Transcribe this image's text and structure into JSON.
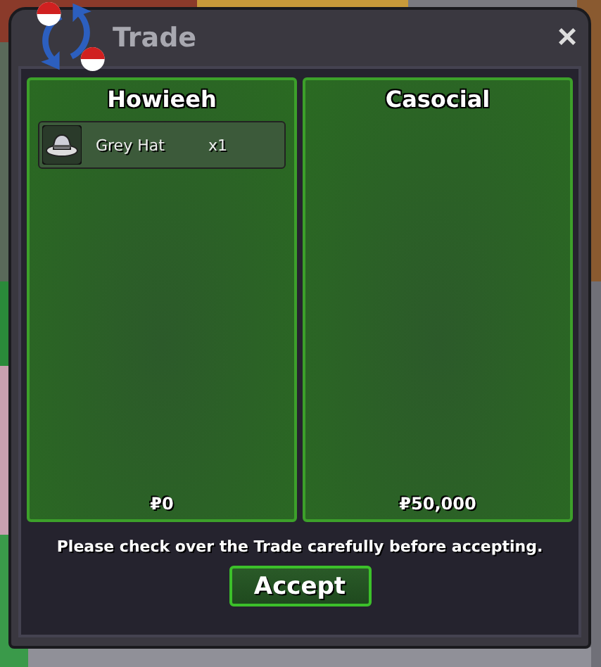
{
  "window": {
    "title": "Trade",
    "close": "×"
  },
  "offers": [
    {
      "player": "Howieeh",
      "items": [
        {
          "name": "Grey Hat",
          "quantity": "x1"
        }
      ],
      "money": "₽0"
    },
    {
      "player": "Casocial",
      "money": "₽50,000"
    }
  ],
  "notice": "Please check over the Trade carefully before accepting.",
  "buttons": [
    "Accept"
  ]
}
